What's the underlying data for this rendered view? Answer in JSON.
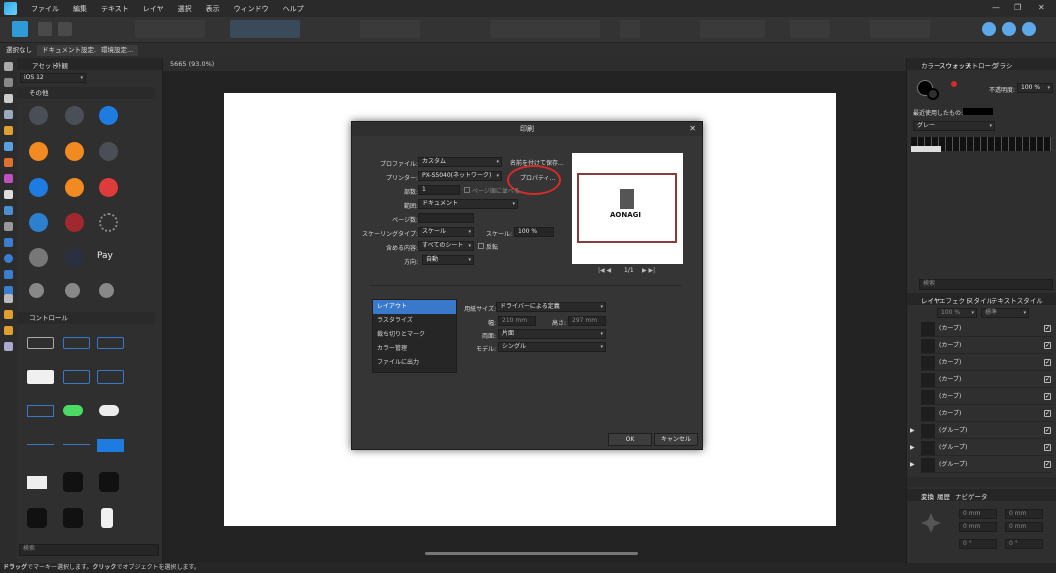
{
  "menu": [
    "ファイル",
    "編集",
    "テキスト",
    "レイヤ",
    "選択",
    "表示",
    "ウィンドウ",
    "ヘルプ"
  ],
  "window_controls": [
    "—",
    "❐",
    "✕"
  ],
  "context": {
    "deselect": "選択なし",
    "doc_setup": "ドキュメント設定...",
    "prefs": "環境設定..."
  },
  "assets_panel": {
    "tab1": "アセット",
    "tab2": "外観",
    "set": "iOS 12",
    "section1": "その他",
    "section2": "コントロール",
    "search_placeholder": "検索"
  },
  "document_tab": "5665 (93.0%)",
  "dialog": {
    "title": "印刷",
    "profile_label": "プロファイル:",
    "profile_value": "カスタム",
    "save_as": "名前を付けて保存...",
    "printer_label": "プリンター:",
    "printer_value": "PX-S5040(ネットワーク)",
    "properties": "プロパティ...",
    "copies_label": "部数:",
    "copies_value": "1",
    "collate": "ページ順に並べる",
    "range_label": "範囲:",
    "range_value": "ドキュメント",
    "pages_label": "ページ数:",
    "scaling_label": "スケーリングタイプ:",
    "scaling_value": "スケール",
    "scale_label": "スケール:",
    "scale_value": "100 %",
    "include_label": "含める内容:",
    "include_value": "すべてのシート",
    "reverse": "反転",
    "orientation_label": "方向:",
    "orientation_value": "自動",
    "preview_brand": "AONAGI",
    "page_indicator": "1/1",
    "list": [
      "レイアウト",
      "ラスタライズ",
      "裁ち切りとマーク",
      "カラー管理",
      "ファイルに出力"
    ],
    "paper_label": "用紙サイズ:",
    "paper_value": "ドライバーによる定義",
    "width_label": "幅:",
    "width_value": "210 mm",
    "height_label": "高さ:",
    "height_value": "297 mm",
    "sides_label": "両面:",
    "sides_value": "片面",
    "model_label": "モデル:",
    "model_value": "シングル",
    "ok": "OK",
    "cancel": "キャンセル"
  },
  "right_panel": {
    "tabs": [
      "カラー",
      "スウォッチ",
      "ストローク",
      "ブラシ"
    ],
    "opacity_label": "不透明度:",
    "opacity_value": "100 %",
    "recent": "最近使用したもの:",
    "palette": "グレー",
    "search_placeholder": "検索",
    "layer_tabs": [
      "レイヤ",
      "エフェクト",
      "スタイル",
      "テキストスタイル"
    ],
    "layer_opacity": "100 %",
    "blend": "標準",
    "layers": [
      "(カーブ)",
      "(カーブ)",
      "(カーブ)",
      "(カーブ)",
      "(カーブ)",
      "(カーブ)",
      "(グループ)",
      "(グループ)",
      "(グループ)"
    ],
    "transform_tabs": [
      "変換",
      "履歴",
      "ナビゲータ"
    ],
    "mm": "0 mm",
    "deg": "0 °"
  },
  "status": {
    "drag": "ドラッグ",
    "t1": "でマーキー選択します。",
    "click": "クリック",
    "t2": "でオブジェクトを選択します。"
  },
  "colors": {
    "accent": "#3a79c9",
    "orange": "#f28a22",
    "red": "#e03b3b",
    "blue": "#1e7be0",
    "highlight_circle": "#d42b2b"
  }
}
